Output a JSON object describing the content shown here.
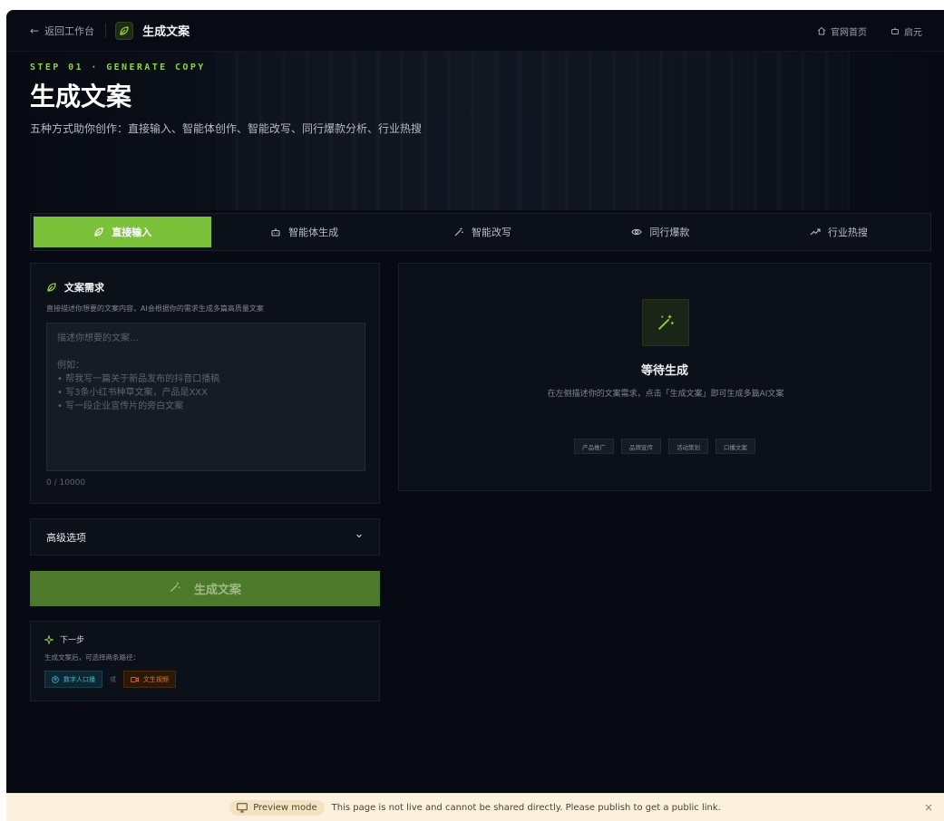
{
  "topbar": {
    "back_label": "返回工作台",
    "title": "生成文案",
    "links": [
      {
        "label": "官网首页",
        "icon": "home-icon"
      },
      {
        "label": "启元",
        "icon": "robot-icon"
      }
    ]
  },
  "hero": {
    "step": "STEP 01 · GENERATE COPY",
    "title": "生成文案",
    "subtitle": "五种方式助你创作：直接输入、智能体创作、智能改写、同行爆款分析、行业热搜"
  },
  "tabs": [
    {
      "label": "直接输入",
      "icon": "leaf-icon",
      "active": true
    },
    {
      "label": "智能体生成",
      "icon": "robot-icon",
      "active": false
    },
    {
      "label": "智能改写",
      "icon": "magic-wand-icon",
      "active": false
    },
    {
      "label": "同行爆款",
      "icon": "eye-icon",
      "active": false
    },
    {
      "label": "行业热搜",
      "icon": "trending-icon",
      "active": false
    }
  ],
  "requirement": {
    "title": "文案需求",
    "description": "直接描述你想要的文案内容，AI会根据你的需求生成多篇高质量文案",
    "placeholder": "描述你想要的文案...\n\n例如：\n• 帮我写一篇关于新品发布的抖音口播稿\n• 写3条小红书种草文案，产品是XXX\n• 写一段企业宣传片的旁白文案",
    "counter": "0 / 10000"
  },
  "advanced": {
    "label": "高级选项"
  },
  "generate_button": {
    "label": "生成文案"
  },
  "next_step": {
    "title": "下一步",
    "description": "生成文案后，可选择两条路径：",
    "path1": "数字人口播",
    "or": "或",
    "path2": "文生视频"
  },
  "output": {
    "title": "等待生成",
    "description": "在左侧描述你的文案需求，点击「生成文案」即可生成多篇AI文案",
    "tags": [
      "产品推广",
      "品牌宣传",
      "活动策划",
      "口播文案"
    ]
  },
  "preview_bar": {
    "badge": "Preview mode",
    "message": "This page is not live and cannot be shared directly. Please publish to get a public link."
  },
  "colors": {
    "accent": "#7cc13a",
    "background": "#070a12",
    "button_disabled": "#4d7a2a"
  }
}
